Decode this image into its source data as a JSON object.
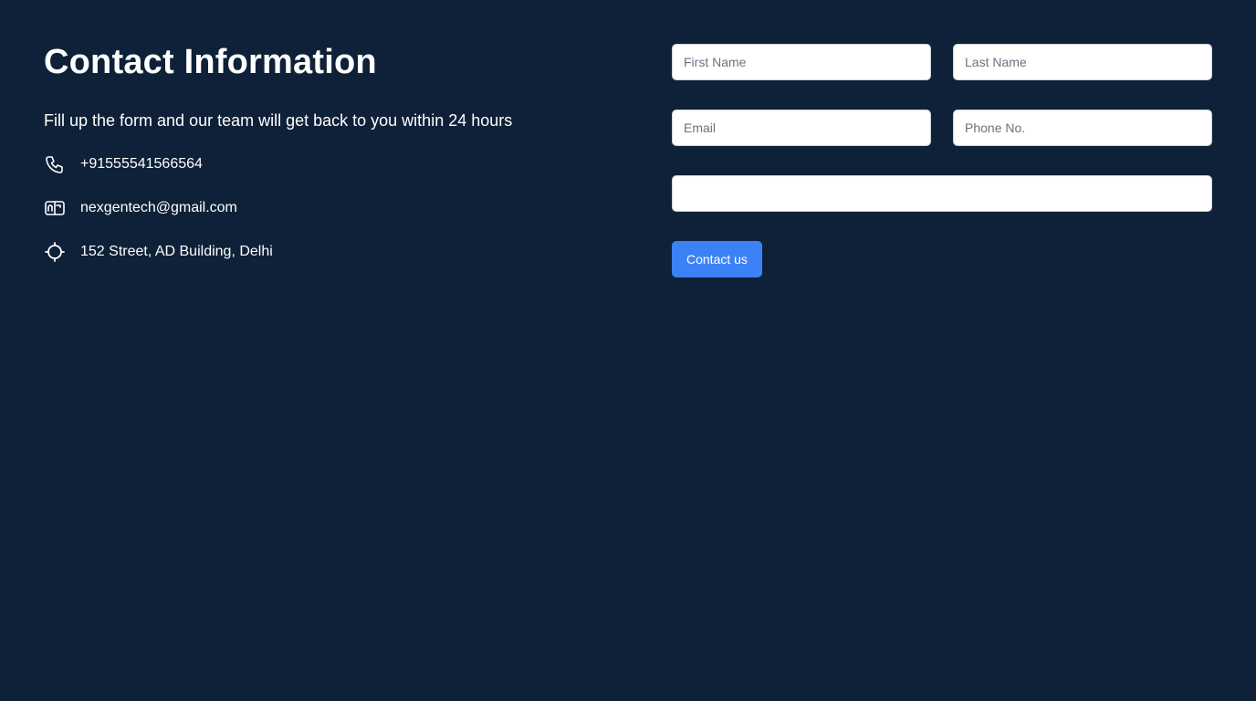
{
  "contact": {
    "title": "Contact Information",
    "subtitle": "Fill up the form and our team will get back to you within 24 hours",
    "items": [
      {
        "icon": "phone-icon",
        "text": "+91555541566564"
      },
      {
        "icon": "mail-icon",
        "text": "nexgentech@gmail.com"
      },
      {
        "icon": "location-icon",
        "text": "152 Street, AD Building, Delhi"
      }
    ]
  },
  "form": {
    "first_name": {
      "placeholder": "First Name",
      "value": ""
    },
    "last_name": {
      "placeholder": "Last Name",
      "value": ""
    },
    "email": {
      "placeholder": "Email",
      "value": ""
    },
    "phone": {
      "placeholder": "Phone No.",
      "value": ""
    },
    "message": {
      "placeholder": "",
      "value": ""
    },
    "submit_label": "Contact us"
  },
  "colors": {
    "background": "#0e2138",
    "accent": "#3b82f6",
    "text": "#ffffff",
    "field_background": "#ffffff"
  }
}
